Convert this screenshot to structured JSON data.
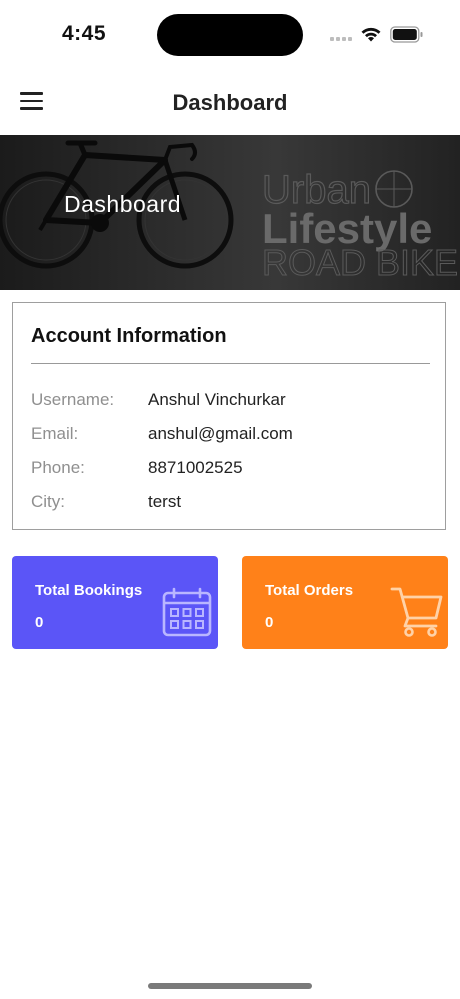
{
  "status_bar": {
    "time": "4:45",
    "icons": [
      "signal-icon",
      "wifi-icon",
      "battery-icon"
    ]
  },
  "header": {
    "title": "Dashboard",
    "menu_icon": "menu-icon"
  },
  "banner": {
    "caption": "Dashboard",
    "brand_line1": "Urban",
    "brand_line2": "Lifestyle",
    "brand_line3": "ROAD BIKE",
    "image": "road-bicycle"
  },
  "account": {
    "title": "Account Information",
    "rows": [
      {
        "label": "Username:",
        "value": "Anshul Vinchurkar"
      },
      {
        "label": "Email:",
        "value": "anshul@gmail.com"
      },
      {
        "label": "Phone:",
        "value": "8871002525"
      },
      {
        "label": "City:",
        "value": "terst"
      }
    ]
  },
  "stats": {
    "bookings": {
      "title": "Total Bookings",
      "count": "0",
      "icon": "calendar-icon",
      "color": "#5b55f7"
    },
    "orders": {
      "title": "Total Orders",
      "count": "0",
      "icon": "cart-icon",
      "color": "#ff8119"
    }
  }
}
